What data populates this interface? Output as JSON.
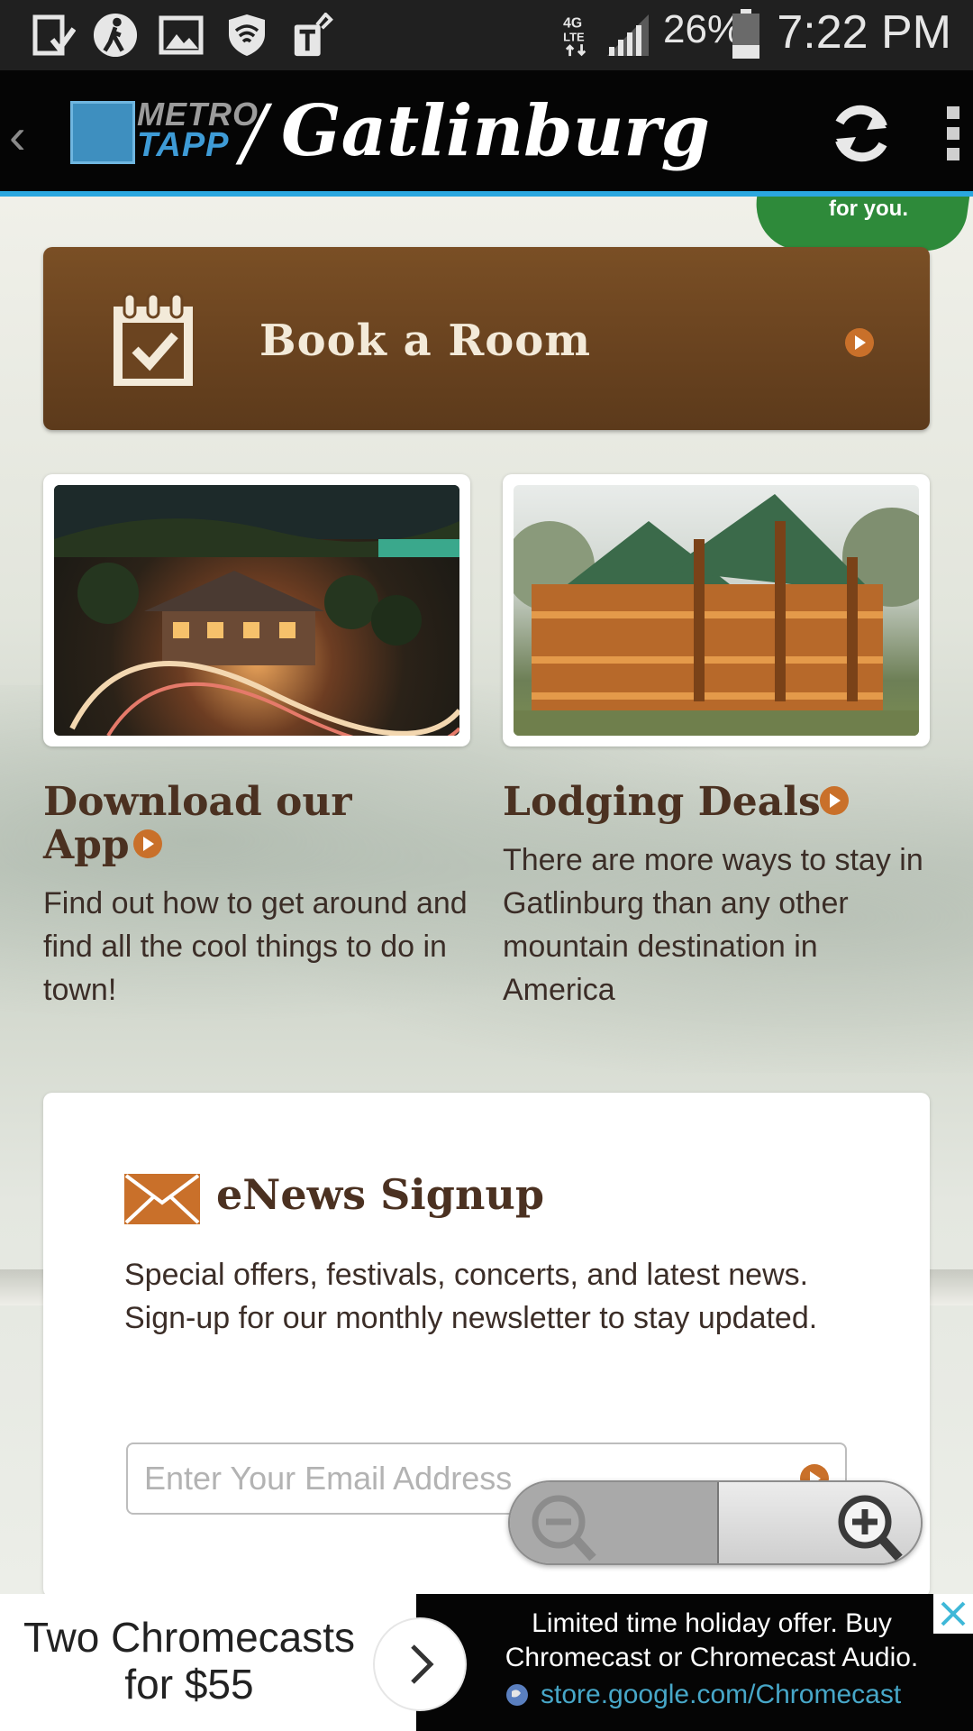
{
  "status_bar": {
    "battery": "26%",
    "time": "7:22 PM",
    "network": "4G LTE"
  },
  "app_bar": {
    "logo_metro": "METRO",
    "logo_tapp": "TAPP",
    "slash": "/",
    "city": "Gatlinburg"
  },
  "corner_badge": "for you.",
  "book_room": {
    "label": "Book a Room"
  },
  "download": {
    "title_line1": "Download our",
    "title_line2": "App",
    "body": "Find out how to get around and find all the cool things to do in town!"
  },
  "lodging": {
    "title": "Lodging Deals",
    "body": "There are more ways to stay in Gatlinburg than any other mountain destination in America"
  },
  "enews": {
    "title": "eNews Signup",
    "body": "Special offers, festivals, concerts, and latest news. Sign-up for our monthly newsletter to stay updated.",
    "email_placeholder": "Enter Your Email Address"
  },
  "ad": {
    "headline": "Two Chromecasts for $55",
    "description": "Limited time holiday offer. Buy Chromecast or Chromecast Audio.",
    "url": "store.google.com/Chromecast"
  },
  "colors": {
    "accent_blue": "#2aa7df",
    "brown_button": "#6b4420",
    "orange_arrow": "#c9702a",
    "heading_brown": "#4b3121"
  }
}
